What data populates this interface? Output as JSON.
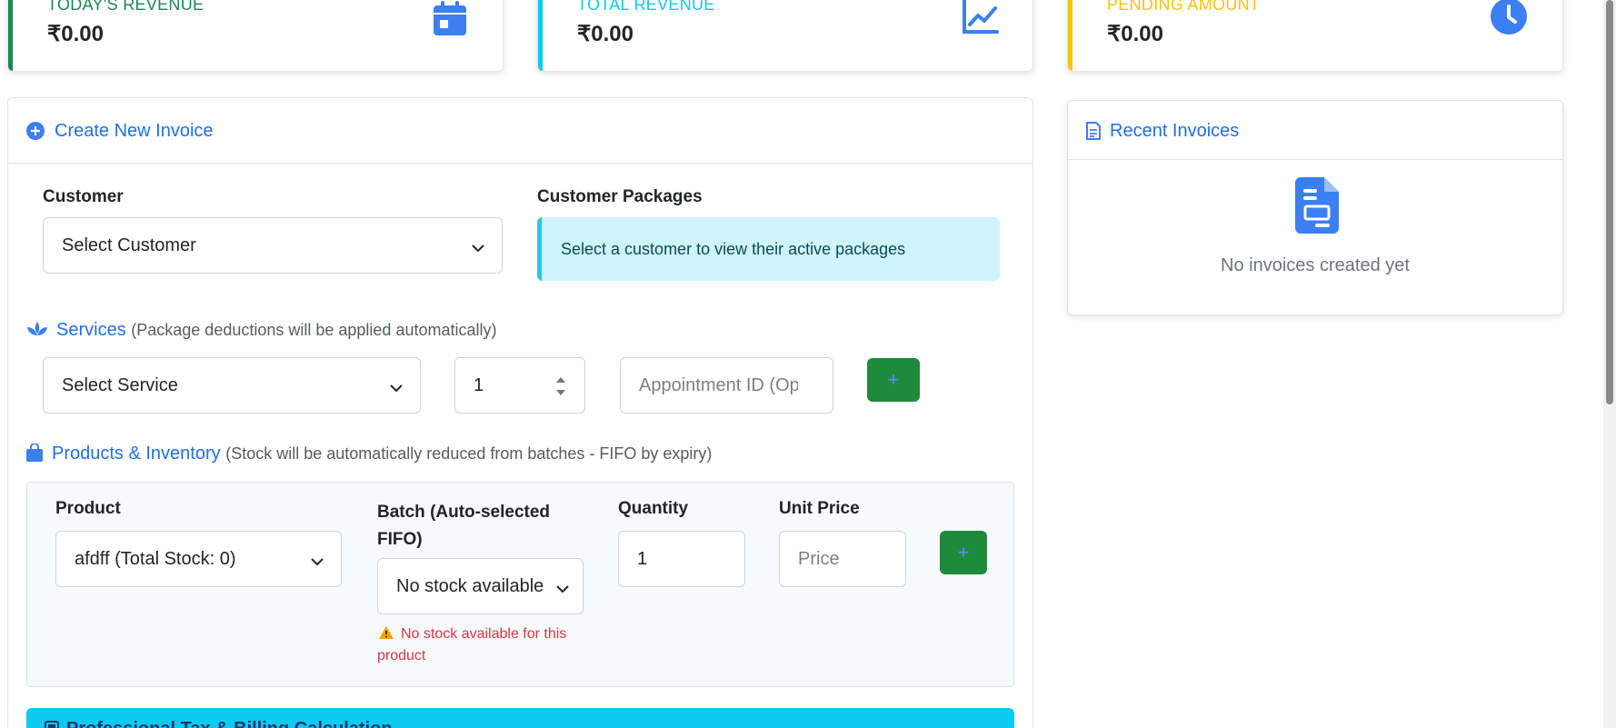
{
  "stats": [
    {
      "label": "TODAY'S REVENUE",
      "value": "₹0.00",
      "accent": "#198754",
      "icon": "calendar-icon"
    },
    {
      "label": "TOTAL REVENUE",
      "value": "₹0.00",
      "accent": "#0dcaf0",
      "icon": "line-chart-icon"
    },
    {
      "label": "PENDING AMOUNT",
      "value": "₹0.00",
      "accent": "#ffc107",
      "icon": "clock-icon"
    }
  ],
  "invoice": {
    "title": "Create New Invoice",
    "customer_label": "Customer",
    "customer_select": "Select Customer",
    "packages_label": "Customer Packages",
    "packages_info": "Select a customer to view their active packages",
    "services": {
      "title": "Services",
      "hint": "(Package deductions will be applied automatically)",
      "service_select": "Select Service",
      "quantity": "1",
      "appointment_placeholder": "Appointment ID (Optional)",
      "add_label": "+"
    },
    "products": {
      "title": "Products & Inventory",
      "hint": "(Stock will be automatically reduced from batches - FIFO by expiry)",
      "product_label": "Product",
      "product_select": "afdff (Total Stock: 0)",
      "batch_label": "Batch (Auto-selected FIFO)",
      "batch_select": "No stock available",
      "stock_warning": "No stock available for this product",
      "quantity_label": "Quantity",
      "quantity_value": "1",
      "unit_price_label": "Unit Price",
      "price_placeholder": "Price",
      "add_label": "+"
    },
    "tax_title": "Professional Tax & Billing Calculation"
  },
  "recent": {
    "title": "Recent Invoices",
    "empty_text": "No invoices created yet"
  },
  "colors": {
    "primary": "#1f6feb",
    "success": "#1e8a3b",
    "info": "#0dcaf0",
    "warning": "#ffc107",
    "danger": "#dc3545"
  }
}
